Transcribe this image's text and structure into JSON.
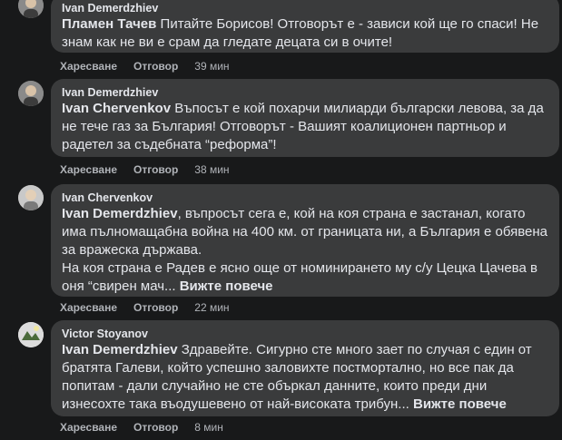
{
  "comments": [
    {
      "author": "Ivan Demerdzhiev",
      "mention": "Пламен Тачев",
      "text": "Питайте Борисов! Отговорът е - зависи кой ще го спаси! Не знам как не ви е срам да гледате децата си в очите!",
      "more": "",
      "like": "Харесване",
      "reply": "Отговор",
      "time": "39 мин"
    },
    {
      "author": "Ivan Demerdzhiev",
      "mention": "Ivan Chervenkov",
      "text": "Въпосът е кой похарчи милиарди български левова, за да не тече газ за България! Отговорът - Вашият коалиционен партньор и радетел за съдебната “реформа”!",
      "more": "",
      "like": "Харесване",
      "reply": "Отговор",
      "time": "38 мин"
    },
    {
      "author": "Ivan Chervenkov",
      "mention": "Ivan Demerdzhiev",
      "text": ", въпросът сега е, кой на коя страна е застанал, когато има пълномащабна война на 400 км. от границата ни, а България е обявена за вражеска държава.",
      "text2": "На коя страна е Радев е ясно още от номинирането му с/у Цецка Цачева в оня “свирен мач...",
      "more": "Вижте повече",
      "like": "Харесване",
      "reply": "Отговор",
      "time": "22 мин"
    },
    {
      "author": "Victor Stoyanov",
      "mention": "Ivan Demerdzhiev",
      "text": "Здравейте. Сигурно сте много зает по случая с един от братята Галеви, който успешно заловихте постмортално, но все пак да попитам - дали случайно не сте объркал данните, които преди дни изнесохте така въодушевено от най-високата трибун...",
      "more": "Вижте повече",
      "like": "Харесване",
      "reply": "Отговор",
      "time": "8 мин"
    }
  ],
  "colors": {
    "background": "#18191a",
    "bubble": "#3a3b3c",
    "text": "#e4e6eb",
    "secondary": "#b0b3b8"
  },
  "icons": [
    "avatar-photo"
  ]
}
